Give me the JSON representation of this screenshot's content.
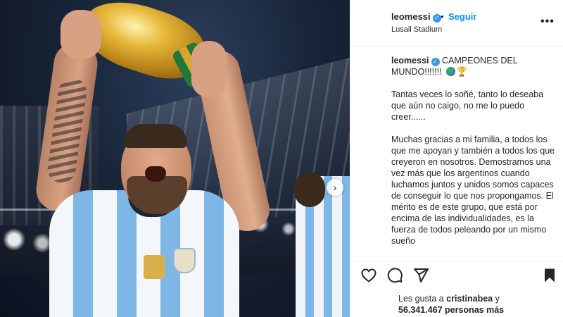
{
  "post": {
    "username": "leomessi",
    "separator": "•",
    "follow_label": "Seguir",
    "location": "Lusail Stadium",
    "more_label": "•••",
    "next_label": "›"
  },
  "caption": {
    "username": "leomessi",
    "title": "CAMPEONES DEL MUNDO!!!!!!!",
    "paragraphs": [
      "Tantas veces lo soñé, tanto lo deseaba que aún no caigo, no me lo puedo creer......",
      "Muchas gracias a mi familia, a todos los que me apoyan y también a todos los que creyeron en nosotros. Demostramos una vez más que los argentinos cuando luchamos juntos y unidos somos capaces de conseguir lo que nos propongamos. El mérito es de este grupo, que está por encima de las individualidades, es la fuerza de todos peleando por un mismo sueño"
    ]
  },
  "likes": {
    "prefix": "Les gusta a",
    "user": "cristinabea",
    "connector": "y",
    "count": "56.341.467 personas más"
  },
  "icons": {
    "like": "heart-icon",
    "comment": "comment-icon",
    "share": "share-icon",
    "save": "bookmark-icon",
    "verified": "verified-badge-icon"
  },
  "colors": {
    "follow": "#0095f6",
    "verified": "#3897f0",
    "text": "#262626"
  }
}
